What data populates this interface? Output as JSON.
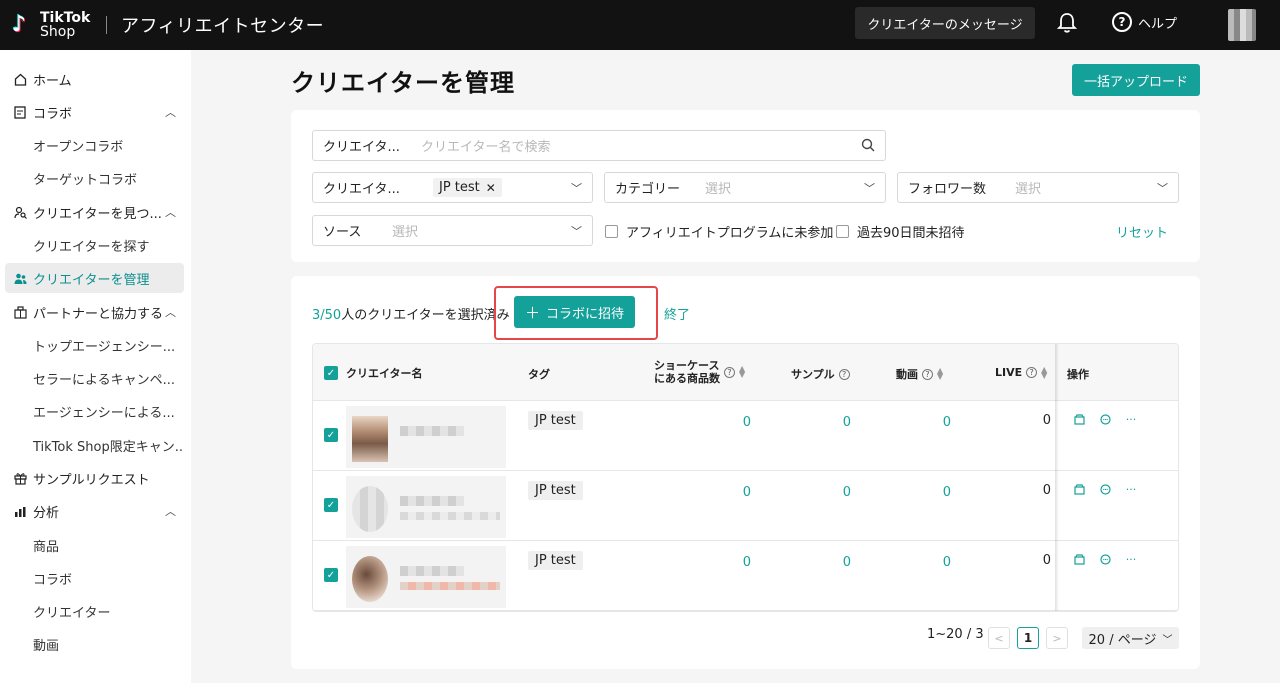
{
  "topbar": {
    "logo_line1": "TikTok",
    "logo_line2": "Shop",
    "app_title": "アフィリエイトセンター",
    "messages_button": "クリエイターのメッセージ",
    "help_label": "ヘルプ"
  },
  "sidebar": {
    "home": "ホーム",
    "collab": "コラボ",
    "collab_open": "オープンコラボ",
    "collab_target": "ターゲットコラボ",
    "find_creators": "クリエイターを見つ...",
    "find_creators_search": "クリエイターを探す",
    "manage_creators": "クリエイターを管理",
    "partner": "パートナーと協力する",
    "partner_top_agency": "トップエージェンシー...",
    "partner_seller_campaign": "セラーによるキャンペ...",
    "partner_agency": "エージェンシーによる...",
    "partner_tiktok_shop": "TikTok Shop限定キャン...",
    "sample_request": "サンプルリクエスト",
    "analytics": "分析",
    "analytics_products": "商品",
    "analytics_collab": "コラボ",
    "analytics_creators": "クリエイター",
    "analytics_videos": "動画"
  },
  "page": {
    "title": "クリエイターを管理",
    "bulk_upload_button": "一括アップロード"
  },
  "filters": {
    "creator_search_label": "クリエイタ...",
    "creator_search_placeholder": "クリエイター名で検索",
    "creator_tag_label": "クリエイタ...",
    "creator_tag_value": "JP test",
    "category_label": "カテゴリー",
    "category_placeholder": "選択",
    "followers_label": "フォロワー数",
    "followers_placeholder": "選択",
    "source_label": "ソース",
    "source_placeholder": "選択",
    "not_in_program_label": "アフィリエイトプログラムに未参加",
    "not_invited_label": "過去90日間未招待",
    "reset_label": "リセット"
  },
  "selection": {
    "count": "3/50",
    "suffix": "人のクリエイターを選択済み",
    "invite_button": "コラボに招待",
    "end_link": "終了"
  },
  "table": {
    "headers": {
      "creator_name": "クリエイター名",
      "tag": "タグ",
      "showcase_line1": "ショーケース",
      "showcase_line2": "にある商品数",
      "sample": "サンプル",
      "video": "動画",
      "live": "LIVE",
      "actions": "操作"
    },
    "rows": [
      {
        "tag": "JP test",
        "showcase": "0",
        "sample": "0",
        "video": "0",
        "live": "0"
      },
      {
        "tag": "JP test",
        "showcase": "0",
        "sample": "0",
        "video": "0",
        "live": "0"
      },
      {
        "tag": "JP test",
        "showcase": "0",
        "sample": "0",
        "video": "0",
        "live": "0"
      }
    ]
  },
  "pagination": {
    "range": "1~20 / 3",
    "current_page": "1",
    "page_size": "20 / ページ"
  },
  "colors": {
    "accent": "#14a19a",
    "highlight": "#e64646",
    "topbar": "#121212"
  }
}
